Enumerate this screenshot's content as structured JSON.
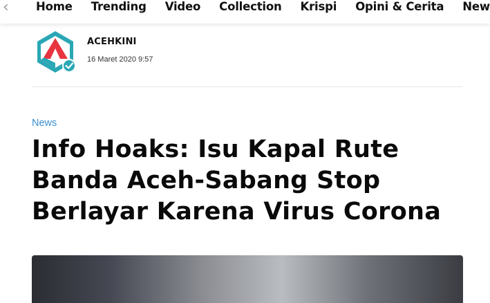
{
  "nav": {
    "back_icon": "chevron-left-icon",
    "items": [
      "Home",
      "Trending",
      "Video",
      "Collection",
      "Krispi",
      "Opini & Cerita",
      "News"
    ]
  },
  "author": {
    "name": "ACEHKINI",
    "date": "16 Maret 2020 9:57",
    "logo_icon": "acehkini-hexagon-logo",
    "verified_icon": "verified-check-icon"
  },
  "article": {
    "category": "News",
    "title": "Info Hoaks: Isu Kapal Rute Banda Aceh-Sabang Stop Berlayar Karena Virus Corona"
  },
  "colors": {
    "accent": "#3b8fd1",
    "logo_teal": "#2aa7b5",
    "logo_red": "#e8343f"
  }
}
